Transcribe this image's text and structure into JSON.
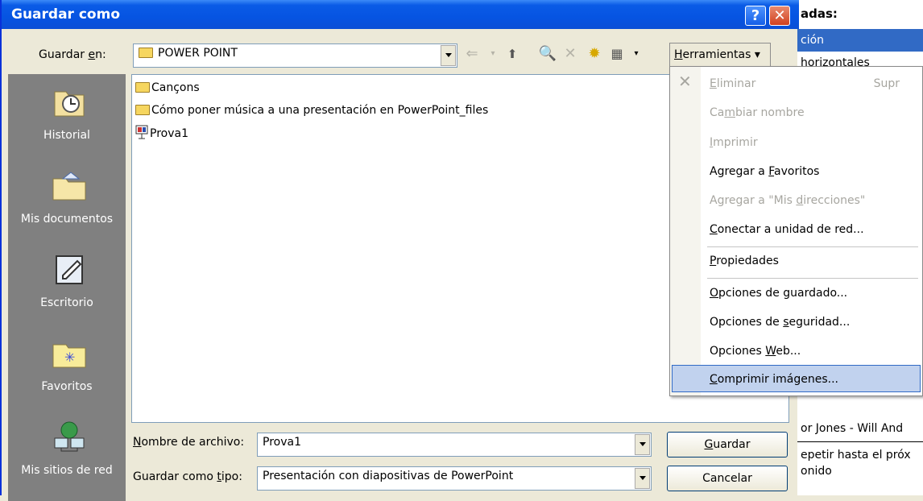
{
  "window": {
    "title": "Guardar como",
    "help_label": "?",
    "close_label": "✕"
  },
  "save_in": {
    "label_pre": "Guardar ",
    "label_u": "e",
    "label_post": "n:",
    "value": "POWER POINT"
  },
  "toolbar": {
    "back_icon": "⇐",
    "up_icon": "⬆",
    "search_icon": "🔍",
    "delete_icon": "✕",
    "newfolder_icon": "✹",
    "views_icon": "▦",
    "tools_u": "H",
    "tools_rest": "erramientas ▾"
  },
  "places": [
    {
      "label": "Historial",
      "icon": "history-icon"
    },
    {
      "label": "Mis documentos",
      "icon": "my-documents-icon"
    },
    {
      "label": "Escritorio",
      "icon": "desktop-icon"
    },
    {
      "label": "Favoritos",
      "icon": "favorites-icon"
    },
    {
      "label": "Mis sitios de red",
      "icon": "network-places-icon"
    }
  ],
  "files": [
    {
      "name": "Cançons",
      "type": "folder"
    },
    {
      "name": "Cómo poner música a una presentación en PowerPoint_files",
      "type": "folder"
    },
    {
      "name": "Prova1",
      "type": "presentation"
    }
  ],
  "filename": {
    "label_u": "N",
    "label_rest": "ombre de archivo:",
    "value": "Prova1"
  },
  "filetype": {
    "label_pre": "Guardar como ",
    "label_u": "t",
    "label_post": "ipo:",
    "value": "Presentación con diapositivas de PowerPoint"
  },
  "buttons": {
    "save_u": "G",
    "save_rest": "uardar",
    "cancel": "Cancelar"
  },
  "menu": {
    "eliminar": {
      "pre": "",
      "u": "E",
      "post": "liminar",
      "shortcut": "Supr"
    },
    "cambiar": {
      "pre": "Ca",
      "u": "m",
      "post": "biar nombre"
    },
    "imprimir": {
      "pre": "",
      "u": "I",
      "post": "mprimir"
    },
    "favoritos": {
      "pre": "Agregar a ",
      "u": "F",
      "post": "avoritos"
    },
    "direcciones": {
      "pre": "Agregar a \"Mis ",
      "u": "d",
      "post": "irecciones\""
    },
    "conectar": {
      "pre": "",
      "u": "C",
      "post": "onectar a unidad de red..."
    },
    "propiedades": {
      "pre": "",
      "u": "P",
      "post": "ropiedades"
    },
    "guardado": {
      "pre": "",
      "u": "O",
      "post": "pciones de guardado..."
    },
    "seguridad": {
      "pre": "Opciones de ",
      "u": "s",
      "post": "eguridad..."
    },
    "web": {
      "pre": "Opciones ",
      "u": "W",
      "post": "eb..."
    },
    "comprimir": {
      "pre": "",
      "u": "C",
      "post": "omprimir imágenes..."
    }
  },
  "background": {
    "header": "adas:",
    "selected": "ción",
    "row1": "horizontales",
    "row2": "or Jones - Will And",
    "row3": "epetir hasta el próx",
    "row4": "onido"
  }
}
